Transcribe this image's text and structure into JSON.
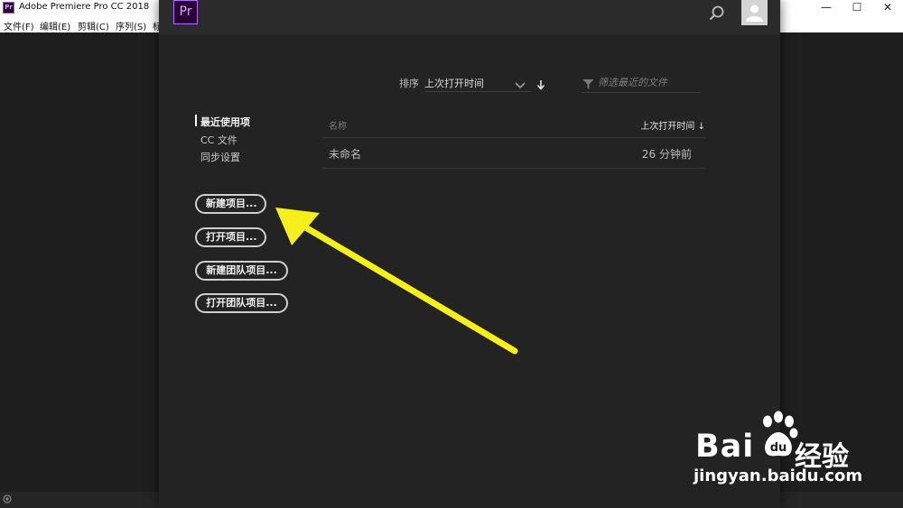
{
  "app": {
    "window_title": "Adobe Premiere Pro CC 2018",
    "icon_label": "Pr",
    "window_controls": [
      "—",
      "☐",
      "✕"
    ]
  },
  "menu": [
    "文件(F)",
    "编辑(E)",
    "剪辑(C)",
    "序列(S)",
    "标"
  ],
  "dialog": {
    "logo": "Pr",
    "sort": {
      "label": "排序",
      "value": "上次打开时间"
    },
    "filter": {
      "placeholder": "筛选最近的文件"
    },
    "nav": [
      {
        "label": "最近使用项",
        "active": true
      },
      {
        "label": "CC 文件",
        "active": false
      },
      {
        "label": "同步设置",
        "active": false
      }
    ],
    "buttons": [
      "新建项目...",
      "打开项目...",
      "新建团队项目...",
      "打开团队项目..."
    ],
    "table": {
      "columns": {
        "name": "名称",
        "opened": "上次打开时间 ↓"
      },
      "rows": [
        {
          "name": "未命名",
          "opened": "26 分钟前"
        }
      ]
    }
  },
  "watermark": {
    "brand": "Bai",
    "brand2": "经验",
    "url": "jingyan.baidu.com"
  },
  "colors": {
    "accent_purple": "#b46cff",
    "highlight_arrow": "#f5ef1b"
  }
}
